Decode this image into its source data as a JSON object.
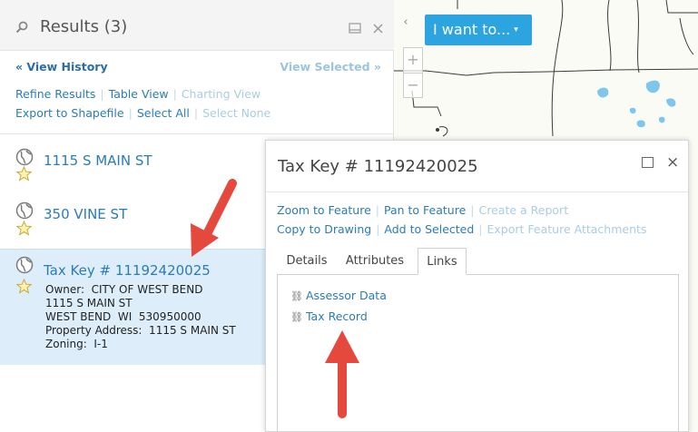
{
  "results": {
    "title": "Results (3)",
    "icons": {
      "search": "magnifier-icon",
      "minimize": "minimize-icon",
      "close": "close-icon"
    },
    "view_history": "« View History",
    "view_selected": "View Selected »",
    "actions_row1": {
      "refine": "Refine Results",
      "table": "Table View",
      "charting": "Charting View"
    },
    "actions_row2": {
      "export": "Export to Shapefile",
      "select_all": "Select All",
      "select_none": "Select None"
    },
    "items": [
      {
        "name": "1115 S MAIN ST"
      },
      {
        "name": "350 VINE ST"
      },
      {
        "name": "Tax Key # 11192420025",
        "details": "Owner:  CITY OF WEST BEND\n1115 S MAIN ST\nWEST BEND  WI  530950000\nProperty Address:  1115 S MAIN ST\nZoning:  I-1"
      }
    ]
  },
  "map": {
    "collapse": "‹",
    "zoom_in": "+",
    "zoom_out": "−",
    "i_want_to": "I want to...",
    "i_want_to_caret": "▾"
  },
  "popup": {
    "title": "Tax Key #  11192420025",
    "close": "×",
    "actions_row1": {
      "zoom": "Zoom to Feature",
      "pan": "Pan to Feature",
      "report": "Create a Report"
    },
    "actions_row2": {
      "copy": "Copy to Drawing",
      "add": "Add to Selected",
      "export": "Export Feature Attachments"
    },
    "tabs": {
      "details": "Details",
      "attributes": "Attributes",
      "links": "Links"
    },
    "links": {
      "assessor": "Assessor Data",
      "tax_record": "Tax Record"
    }
  },
  "colors": {
    "accent": "#2ba4e0",
    "link": "#2b7bb9",
    "selected_bg": "#ddeefa",
    "arrow": "#e5483d"
  }
}
